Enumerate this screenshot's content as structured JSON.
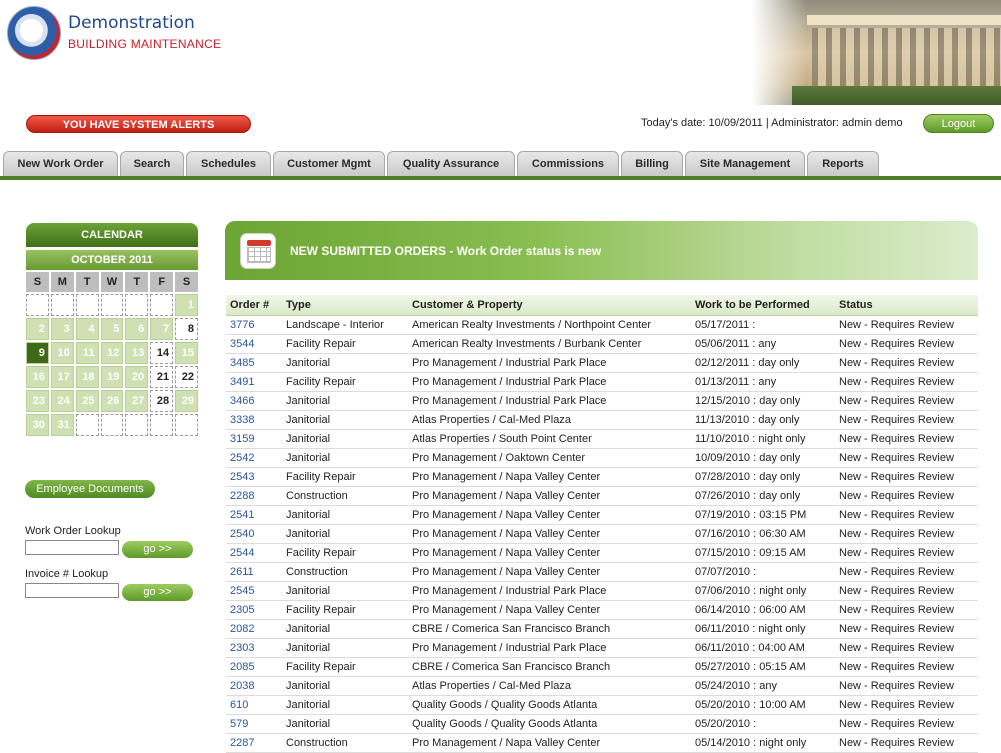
{
  "header": {
    "brand_name": "Demonstration",
    "brand_sub": "BUILDING MAINTENANCE"
  },
  "alert": "YOU HAVE SYSTEM ALERTS",
  "status": "Today's date: 10/09/2011   |  Administrator: admin demo",
  "logout": "Logout",
  "nav": [
    "New Work Order",
    "Search",
    "Schedules",
    "Customer Mgmt",
    "Quality Assurance",
    "Commissions",
    "Billing",
    "Site Management",
    "Reports"
  ],
  "calendar": {
    "title": "CALENDAR",
    "month": "OCTOBER 2011",
    "dow": [
      "S",
      "M",
      "T",
      "W",
      "T",
      "F",
      "S"
    ],
    "weeks": [
      [
        "",
        "",
        "",
        "",
        "",
        "",
        "1"
      ],
      [
        "2",
        "3",
        "4",
        "5",
        "6",
        "7",
        "8"
      ],
      [
        "9",
        "10",
        "11",
        "12",
        "13",
        "14",
        "15"
      ],
      [
        "16",
        "17",
        "18",
        "19",
        "20",
        "21",
        "22"
      ],
      [
        "23",
        "24",
        "25",
        "26",
        "27",
        "28",
        "29"
      ],
      [
        "30",
        "31",
        "",
        "",
        "",
        "",
        ""
      ]
    ]
  },
  "sidebar": {
    "employee_docs": "Employee Documents",
    "wo_lookup_label": "Work Order Lookup",
    "inv_lookup_label": "Invoice # Lookup",
    "go": "go >>"
  },
  "panel": {
    "title": "NEW SUBMITTED ORDERS - Work Order status is new"
  },
  "table": {
    "headers": [
      "Order #",
      "Type",
      "Customer & Property",
      "Work to be Performed",
      "Status"
    ],
    "rows": [
      [
        "3776",
        "Landscape - Interior",
        "American Realty Investments / Northpoint Center",
        "05/17/2011 :",
        "New - Requires Review"
      ],
      [
        "3544",
        "Facility Repair",
        "American Realty Investments / Burbank Center",
        "05/06/2011 : any",
        "New - Requires Review"
      ],
      [
        "3485",
        "Janitorial",
        "Pro Management / Industrial Park Place",
        "02/12/2011 : day only",
        "New - Requires Review"
      ],
      [
        "3491",
        "Facility Repair",
        "Pro Management / Industrial Park Place",
        "01/13/2011 : any",
        "New - Requires Review"
      ],
      [
        "3466",
        "Janitorial",
        "Pro Management / Industrial Park Place",
        "12/15/2010 : day only",
        "New - Requires Review"
      ],
      [
        "3338",
        "Janitorial",
        "Atlas Properties / Cal-Med Plaza",
        "11/13/2010 : day only",
        "New - Requires Review"
      ],
      [
        "3159",
        "Janitorial",
        "Atlas Properties / South Point Center",
        "11/10/2010 : night only",
        "New - Requires Review"
      ],
      [
        "2542",
        "Janitorial",
        "Pro Management / Oaktown Center",
        "10/09/2010 : day only",
        "New - Requires Review"
      ],
      [
        "2543",
        "Facility Repair",
        "Pro Management / Napa Valley Center",
        "07/28/2010 : day only",
        "New - Requires Review"
      ],
      [
        "2288",
        "Construction",
        "Pro Management / Napa Valley Center",
        "07/26/2010 : day only",
        "New - Requires Review"
      ],
      [
        "2541",
        "Janitorial",
        "Pro Management / Napa Valley Center",
        "07/19/2010 : 03:15 PM",
        "New - Requires Review"
      ],
      [
        "2540",
        "Janitorial",
        "Pro Management / Napa Valley Center",
        "07/16/2010 : 06:30 AM",
        "New - Requires Review"
      ],
      [
        "2544",
        "Facility Repair",
        "Pro Management / Napa Valley Center",
        "07/15/2010 : 09:15 AM",
        "New - Requires Review"
      ],
      [
        "2611",
        "Construction",
        "Pro Management / Napa Valley Center",
        "07/07/2010 :",
        "New - Requires Review"
      ],
      [
        "2545",
        "Janitorial",
        "Pro Management / Industrial Park Place",
        "07/06/2010 : night only",
        "New - Requires Review"
      ],
      [
        "2305",
        "Facility Repair",
        "Pro Management / Napa Valley Center",
        "06/14/2010 : 06:00 AM",
        "New - Requires Review"
      ],
      [
        "2082",
        "Janitorial",
        "CBRE / Comerica San Francisco Branch",
        "06/11/2010 : night only",
        "New - Requires Review"
      ],
      [
        "2303",
        "Janitorial",
        "Pro Management / Industrial Park Place",
        "06/11/2010 : 04:00 AM",
        "New - Requires Review"
      ],
      [
        "2085",
        "Facility Repair",
        "CBRE / Comerica San Francisco Branch",
        "05/27/2010 : 05:15 AM",
        "New - Requires Review"
      ],
      [
        "2038",
        "Janitorial",
        "Atlas Properties / Cal-Med Plaza",
        "05/24/2010 : any",
        "New - Requires Review"
      ],
      [
        "610",
        "Janitorial",
        "Quality Goods / Quality Goods Atlanta",
        "05/20/2010 : 10:00 AM",
        "New - Requires Review"
      ],
      [
        "579",
        "Janitorial",
        "Quality Goods / Quality Goods Atlanta",
        "05/20/2010 :",
        "New - Requires Review"
      ],
      [
        "2287",
        "Construction",
        "Pro Management / Napa Valley Center",
        "05/14/2010 : night only",
        "New - Requires Review"
      ]
    ]
  }
}
